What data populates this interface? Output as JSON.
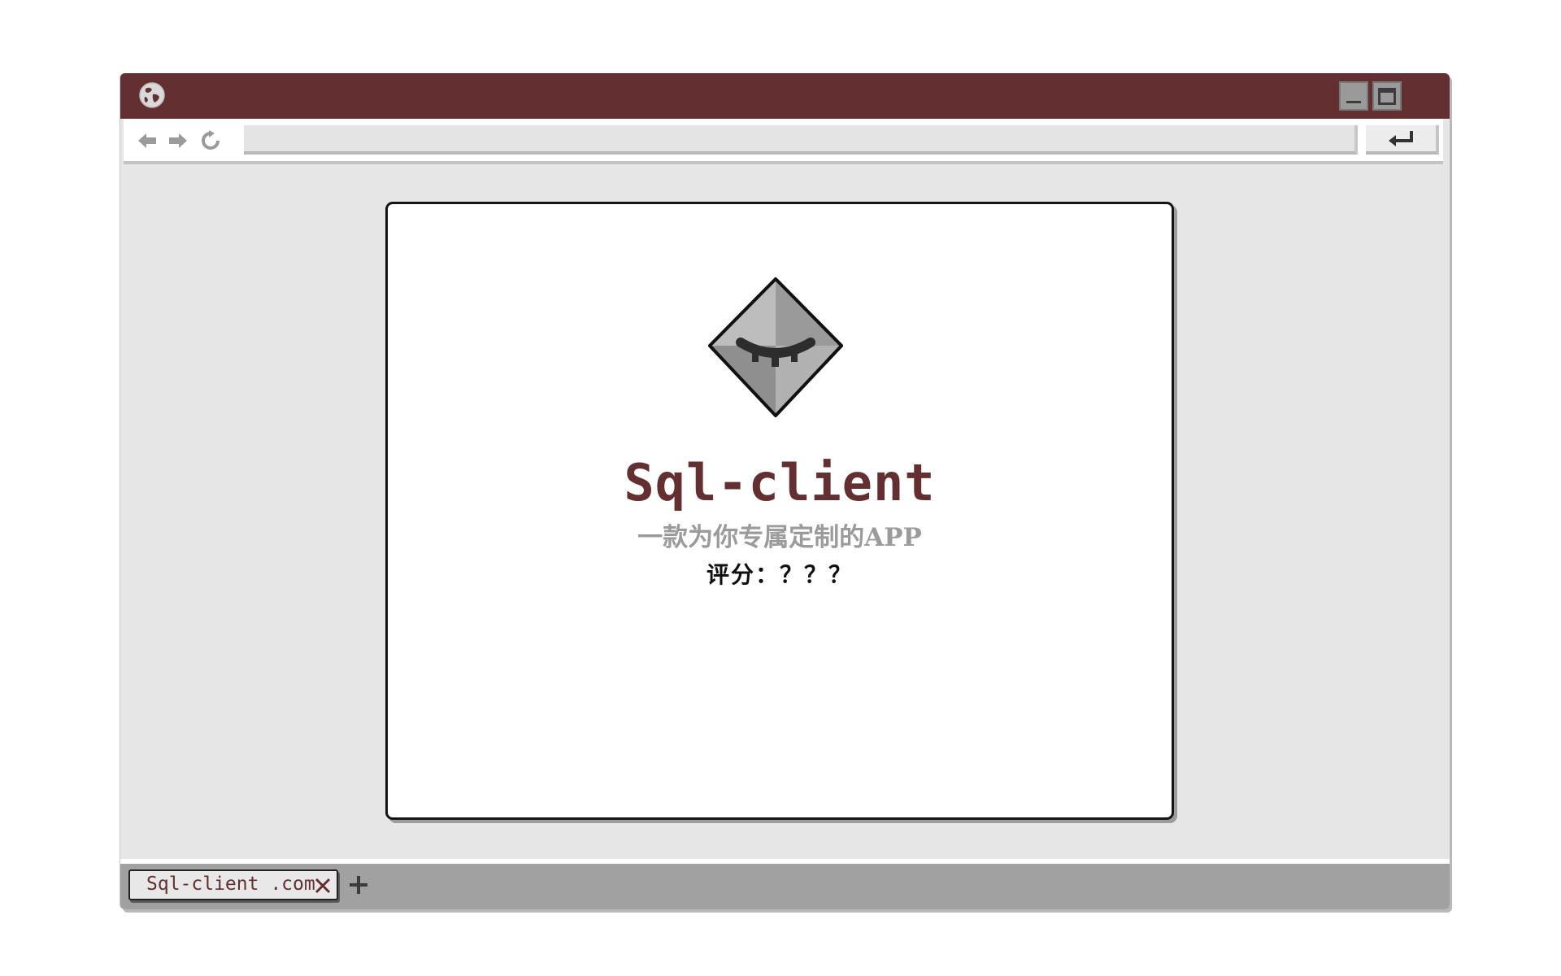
{
  "browser": {
    "address": "",
    "icons": {
      "globe": "globe-icon",
      "back": "arrow-left-icon",
      "forward": "arrow-right-icon",
      "reload": "reload-icon",
      "minimize": "minimize-icon",
      "maximize": "maximize-icon",
      "enter": "enter-return-icon",
      "close_tab": "close-icon",
      "new_tab": "plus-icon"
    }
  },
  "app": {
    "logo": "eye-closed-diamond-logo",
    "title": "Sql-client",
    "subtitle": "一款为你专属定制的APP",
    "rating": "评分：？？？"
  },
  "tabs": [
    {
      "label": "Sql-client .com",
      "active": true
    }
  ],
  "colors": {
    "brand": "#632f30",
    "frame": "#e6e6e6",
    "tabstrip": "#a1a1a1",
    "subtitle": "#9b9b9b"
  }
}
